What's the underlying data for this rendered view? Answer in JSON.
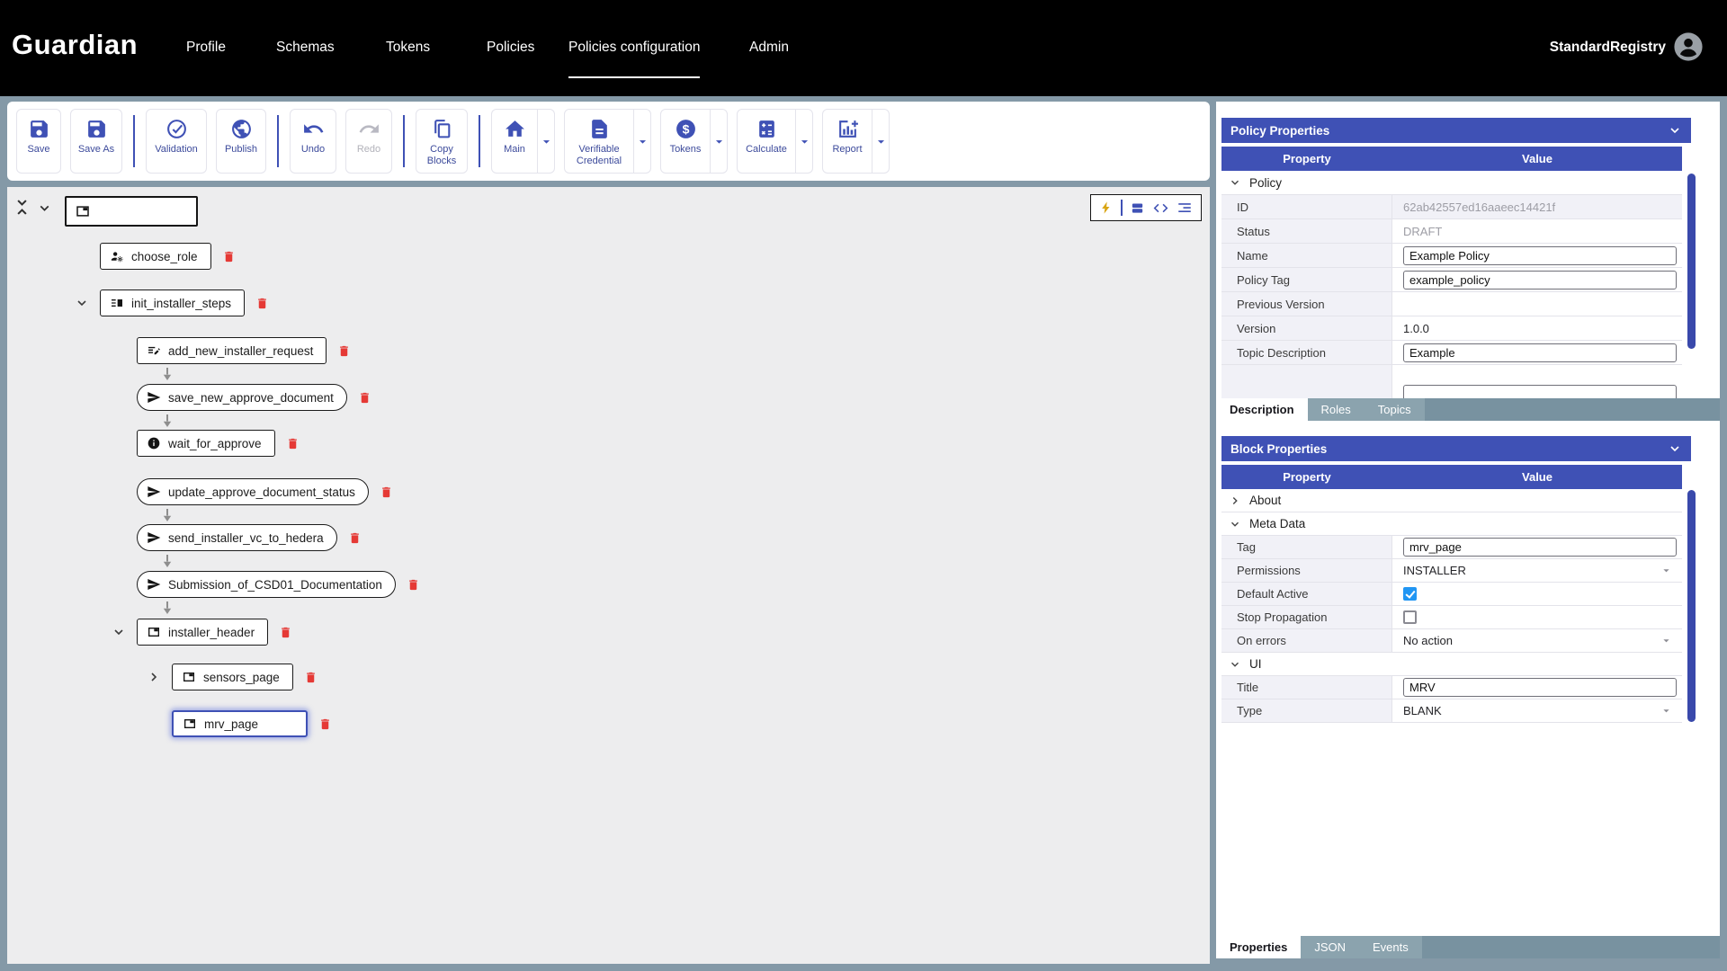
{
  "colors": {
    "accent": "#3f51b5",
    "danger": "#e53935",
    "navbar": "#000000",
    "frame": "#8499a7",
    "canvas_bg": "#ededee",
    "checkbox_on": "#2196f3",
    "bolt": "#d9a514"
  },
  "nav": {
    "logo": "Guardian",
    "items": [
      {
        "label": "Profile"
      },
      {
        "label": "Schemas"
      },
      {
        "label": "Tokens"
      },
      {
        "label": "Policies"
      },
      {
        "label": "Policies configuration",
        "active": true
      },
      {
        "label": "Admin"
      }
    ],
    "user": "StandardRegistry"
  },
  "toolbar": {
    "save": "Save",
    "save_as": "Save As",
    "validation": "Validation",
    "publish": "Publish",
    "undo": "Undo",
    "redo": "Redo",
    "redo_disabled": true,
    "copy_blocks": "Copy Blocks",
    "main": "Main",
    "verifiable_credential": "Verifiable Credential",
    "tokens": "Tokens",
    "calculate": "Calculate",
    "report": "Report"
  },
  "canvas_toggles": {
    "icons": [
      "lightning-bolt",
      "blocks-view",
      "code-view",
      "tree-view"
    ]
  },
  "tree": {
    "root_label": "",
    "nodes": [
      {
        "label": "choose_role",
        "icon": "role-icon",
        "shape": "rect"
      },
      {
        "label": "init_installer_steps",
        "icon": "steps-icon",
        "shape": "rect",
        "expanded": true
      },
      {
        "label": "add_new_installer_request",
        "icon": "request-icon",
        "shape": "rect"
      },
      {
        "label": "save_new_approve_document",
        "icon": "send-icon",
        "shape": "pill"
      },
      {
        "label": "wait_for_approve",
        "icon": "info-icon",
        "shape": "rect"
      },
      {
        "label": "update_approve_document_status",
        "icon": "send-icon",
        "shape": "pill"
      },
      {
        "label": "send_installer_vc_to_hedera",
        "icon": "send-icon",
        "shape": "pill"
      },
      {
        "label": "Submission_of_CSD01_Documentation",
        "icon": "send-icon",
        "shape": "pill"
      },
      {
        "label": "installer_header",
        "icon": "page-icon",
        "shape": "rect",
        "expanded": true
      },
      {
        "label": "sensors_page",
        "icon": "page-icon",
        "shape": "rect",
        "collapsed": true
      },
      {
        "label": "mrv_page",
        "icon": "page-icon",
        "shape": "rect",
        "selected": true
      }
    ]
  },
  "policy_properties": {
    "title": "Policy Properties",
    "col_property": "Property",
    "col_value": "Value",
    "group": "Policy",
    "id_label": "ID",
    "id_value": "62ab42557ed16aaeec14421f",
    "status_label": "Status",
    "status_value": "DRAFT",
    "name_label": "Name",
    "name_value": "Example Policy",
    "policy_tag_label": "Policy Tag",
    "policy_tag_value": "example_policy",
    "previous_version_label": "Previous Version",
    "previous_version_value": "",
    "version_label": "Version",
    "version_value": "1.0.0",
    "topic_description_label": "Topic Description",
    "topic_description_value": "Example",
    "tabs": [
      {
        "label": "Description",
        "active": true
      },
      {
        "label": "Roles"
      },
      {
        "label": "Topics"
      }
    ]
  },
  "block_properties": {
    "title": "Block Properties",
    "col_property": "Property",
    "col_value": "Value",
    "group_about": "About",
    "group_meta": "Meta Data",
    "group_ui": "UI",
    "tag_label": "Tag",
    "tag_value": "mrv_page",
    "permissions_label": "Permissions",
    "permissions_value": "INSTALLER",
    "default_active_label": "Default Active",
    "default_active_checked": true,
    "stop_propagation_label": "Stop Propagation",
    "stop_propagation_checked": false,
    "on_errors_label": "On errors",
    "on_errors_value": "No action",
    "title_label": "Title",
    "title_value": "MRV",
    "type_label": "Type",
    "type_value": "BLANK"
  },
  "bottom_tabs": [
    {
      "label": "Properties",
      "active": true
    },
    {
      "label": "JSON"
    },
    {
      "label": "Events"
    }
  ]
}
